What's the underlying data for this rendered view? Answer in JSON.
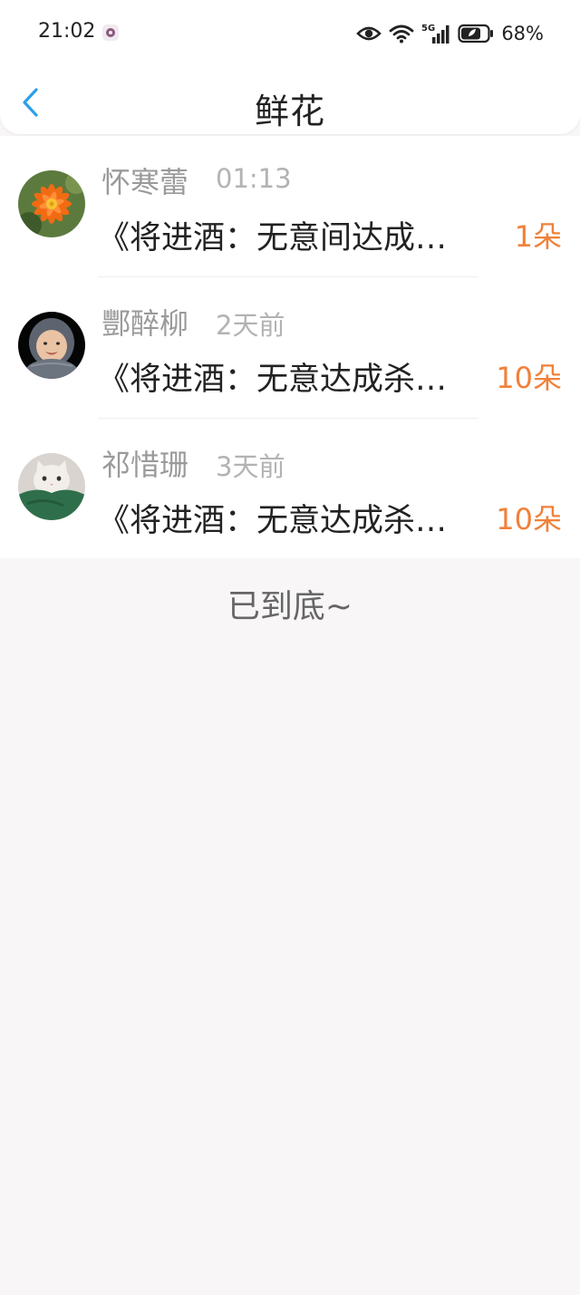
{
  "status_bar": {
    "time": "21:02",
    "battery": "68%",
    "icons": [
      "notification-icon",
      "eye-icon",
      "wifi-icon",
      "signal-5g-icon",
      "battery-icon"
    ]
  },
  "header": {
    "title": "鲜花",
    "back_icon": "chevron-left-icon"
  },
  "items": [
    {
      "name": "怀寒蕾",
      "time": "01:13",
      "message": "《将进酒：无意间达成…",
      "count": "1朵",
      "avatar": "orange-flower"
    },
    {
      "name": "酆醉柳",
      "time": "2天前",
      "message": "《将进酒：无意达成杀…",
      "count": "10朵",
      "avatar": "baby-in-hood"
    },
    {
      "name": "祁惜珊",
      "time": "3天前",
      "message": "《将进酒：无意达成杀…",
      "count": "10朵",
      "avatar": "cat-in-blanket"
    }
  ],
  "footer": {
    "end_text": "已到底~"
  },
  "colors": {
    "accent_back": "#2aa0e8",
    "count_orange": "#f0813a",
    "name_gray": "#9a9a9a",
    "background": "#f8f6f7"
  }
}
